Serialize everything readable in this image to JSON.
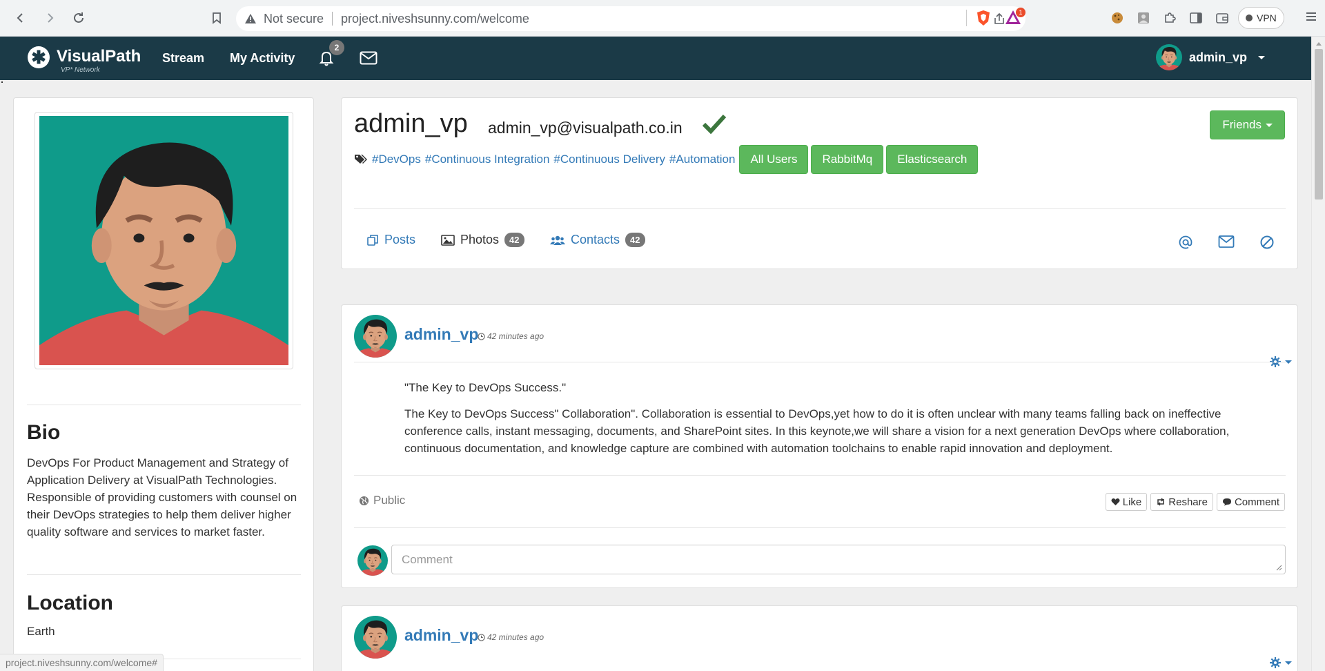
{
  "browser": {
    "security_label": "Not secure",
    "url_host": "project.niveshsunny.com",
    "url_path": "/welcome",
    "bat_badge": "1",
    "vpn_label": "VPN",
    "status_url": "project.niveshsunny.com/welcome#"
  },
  "navbar": {
    "brand": "VisualPath",
    "brand_sub": "VP* Network",
    "stream": "Stream",
    "my_activity": "My Activity",
    "notification_count": "2",
    "username": "admin_vp"
  },
  "profile": {
    "bio_heading": "Bio",
    "bio": "DevOps For Product Management and Strategy of Application Delivery at VisualPath Technologies. Responsible of providing customers with counsel on their DevOps strategies to help them deliver higher quality software and services to market faster.",
    "location_heading": "Location",
    "location": "Earth"
  },
  "header": {
    "name": "admin_vp",
    "email": "admin_vp@visualpath.co.in",
    "friends_label": "Friends",
    "tags": [
      "#DevOps",
      "#Continuous Integration",
      "#Continuous Delivery",
      "#Automation"
    ],
    "groups": [
      "All Users",
      "RabbitMq",
      "Elasticsearch"
    ],
    "tabs": {
      "posts": "Posts",
      "photos": "Photos",
      "photos_count": "42",
      "contacts": "Contacts",
      "contacts_count": "42"
    }
  },
  "posts": [
    {
      "author": "admin_vp",
      "time": "42 minutes ago",
      "title": "\"The Key to DevOps Success.\"",
      "body": "The Key to DevOps Success\" Collaboration\". Collaboration is essential to DevOps,yet how to do it is often unclear with many teams falling back on ineffective conference calls, instant messaging, documents, and SharePoint sites. In this keynote,we will share a vision for a next generation DevOps where collaboration, continuous documentation, and knowledge capture are combined with automation toolchains to enable rapid innovation and deployment.",
      "visibility": "Public",
      "like": "Like",
      "reshare": "Reshare",
      "comment": "Comment",
      "comment_placeholder": "Comment"
    },
    {
      "author": "admin_vp",
      "time": "42 minutes ago"
    }
  ],
  "colors": {
    "navbar_bg": "#1b3a47",
    "link_blue": "#337ab7",
    "success_green": "#5cb85c",
    "avatar_bg": "#0f9b8a"
  }
}
